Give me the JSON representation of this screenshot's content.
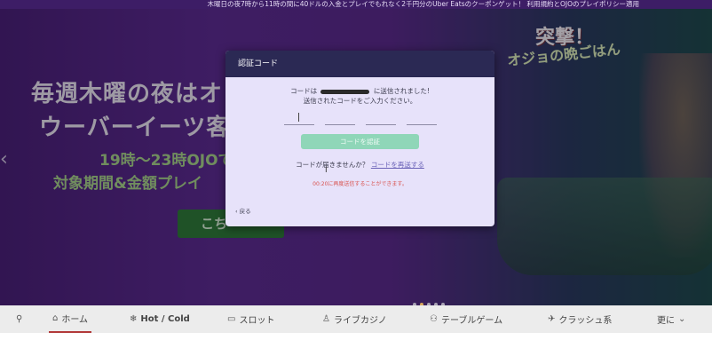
{
  "topbar": {
    "text": "木曜日の夜7時から11時の間に40ドルの入金とプレイでもれなく2千円分のUber Eatsのクーポンゲット！ 利用規約とOJOのプレイポリシー適用"
  },
  "hero": {
    "headline_1": "毎週木曜の夜はオ",
    "headline_2": "ウーバーイーツ客",
    "subline_1": "19時〜23時OJOで",
    "subline_2": "対象期間&金額プレイ",
    "cta_label": "こち",
    "tag_1": "突撃！",
    "tag_2": "オジョの晩ごはん",
    "prev_arrow": "‹",
    "dots": [
      false,
      true,
      false,
      false,
      false
    ]
  },
  "modal": {
    "title": "認証コード",
    "line1_before": "コードは",
    "line1_after": "に送信されました!",
    "line2": "送信されたコードをご入力ください。",
    "confirm_label": "コードを認証",
    "resend_prefix": "コードが届きませんか？",
    "resend_link": "コードを再送する",
    "timer_text": "00:20に再度送信することができます。",
    "back_label": "戻る"
  },
  "nav": {
    "items": [
      {
        "label": "",
        "icon": "search-icon"
      },
      {
        "label": "ホーム",
        "icon": "home-icon"
      },
      {
        "label": "Hot / Cold",
        "icon": "snowflake-icon"
      },
      {
        "label": "スロット",
        "icon": "slot-icon"
      },
      {
        "label": "ライブカジノ",
        "icon": "live-dealer-icon"
      },
      {
        "label": "テーブルゲーム",
        "icon": "table-game-icon"
      },
      {
        "label": "クラッシュ系",
        "icon": "crash-icon"
      },
      {
        "label": "更に",
        "icon": "chevron-down-icon"
      }
    ]
  },
  "colors": {
    "modal_header": "#2b2954",
    "modal_bg": "#e7e2fa",
    "confirm_button": "#8fd6b8",
    "timer_text": "#d9534f",
    "nav_active_underline": "#b23a3a"
  }
}
